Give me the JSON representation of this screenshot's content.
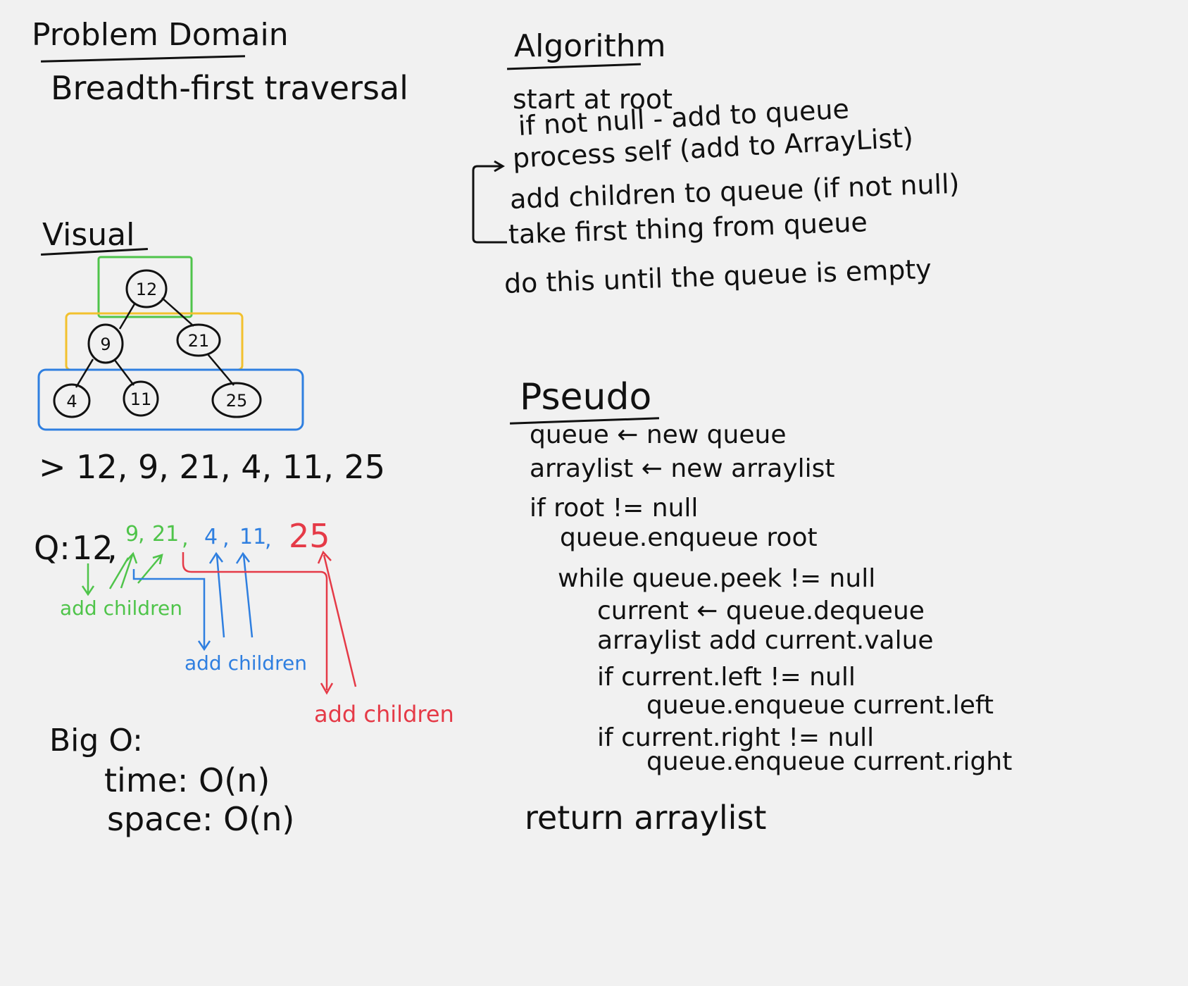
{
  "problem_domain": {
    "heading": "Problem Domain",
    "text": "Breadth-first traversal"
  },
  "algorithm": {
    "heading": "Algorithm",
    "lines": [
      "start at root",
      "if not null - add to queue",
      "process self (add to ArrayList)",
      "add children to queue (if not null)",
      "take first thing from queue",
      "do this until the queue is empty"
    ]
  },
  "visual": {
    "heading": "Visual",
    "nodes": [
      "12",
      "9",
      "21",
      "4",
      "11",
      "25"
    ],
    "level_colors": [
      "#4fc44a",
      "#f2c12e",
      "#2f7fe0"
    ],
    "output": "> 12, 9, 21, 4, 11, 25",
    "queue_label": "Q:",
    "queue_items": [
      {
        "text": "12",
        "color": "#111111"
      },
      {
        "text": "9",
        "color": "#4fc44a"
      },
      {
        "text": "21",
        "color": "#4fc44a"
      },
      {
        "text": "4",
        "color": "#2f7fe0"
      },
      {
        "text": "11",
        "color": "#2f7fe0"
      },
      {
        "text": "25",
        "color": "#e53a47"
      }
    ],
    "annotations": [
      "add children",
      "add children",
      "add children"
    ]
  },
  "big_o": {
    "heading": "Big O:",
    "time": "time: O(n)",
    "space": "space: O(n)"
  },
  "pseudo": {
    "heading": "Pseudo",
    "lines": [
      "queue ← new queue",
      "arraylist ← new arraylist",
      "if root != null",
      "queue.enqueue root",
      "while queue.peek != null",
      "current ← queue.dequeue",
      "arraylist add current.value",
      "if current.left != null",
      "queue.enqueue current.left",
      "if current.right != null",
      "queue.enqueue current.right",
      "return arraylist"
    ]
  }
}
